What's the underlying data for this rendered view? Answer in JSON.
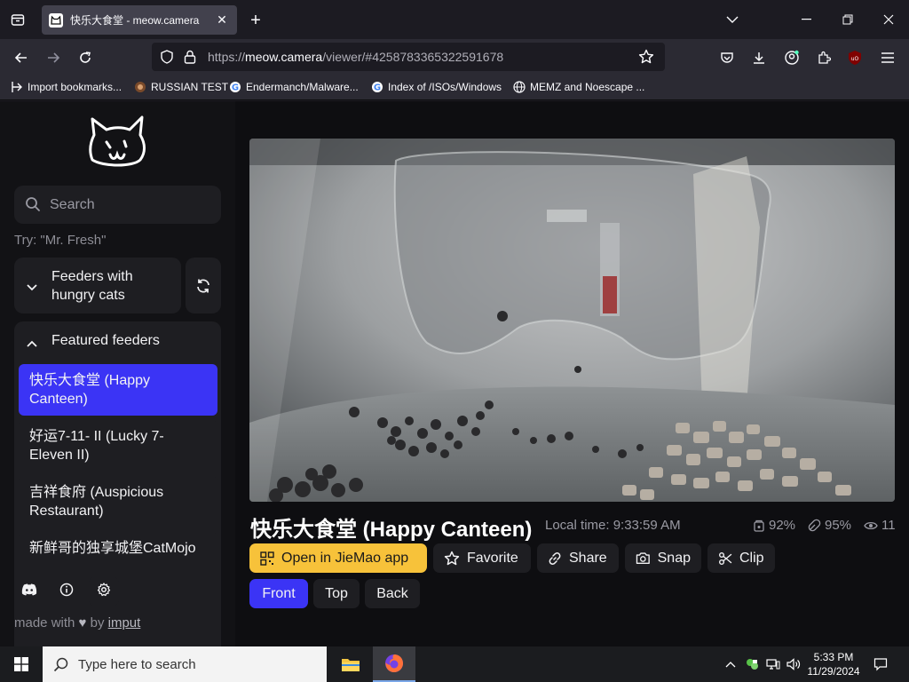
{
  "browser": {
    "tab_title": "快乐大食堂 - meow.camera",
    "url_prefix": "https://",
    "url_host": "meow.camera",
    "url_path": "/viewer/#4258783365322591678",
    "bookmarks": [
      {
        "label": "Import bookmarks...",
        "icon": "import-icon"
      },
      {
        "label": "RUSSIAN TEST",
        "icon": "site-favicon"
      },
      {
        "label": "Endermanch/Malware...",
        "icon": "google-icon"
      },
      {
        "label": "Index of /ISOs/Windows",
        "icon": "google-icon"
      },
      {
        "label": "MEMZ and Noescape ...",
        "icon": "globe-icon"
      }
    ]
  },
  "sidebar": {
    "search_placeholder": "Search",
    "try_hint": "Try: \"Mr. Fresh\"",
    "hungry_label_1": "Feeders with",
    "hungry_label_2": "hungry cats",
    "featured_label": "Featured feeders",
    "feeders": [
      {
        "line1": "快乐大食堂 (Happy",
        "line2": "Canteen)",
        "active": true
      },
      {
        "line1": "好运7-11- II  (Lucky 7-",
        "line2": "Eleven II)",
        "active": false
      },
      {
        "line1": "吉祥食府 (Auspicious",
        "line2": "Restaurant)",
        "active": false
      },
      {
        "line1": "新鲜哥的独享城堡CatMojo",
        "line2": "",
        "active": false
      }
    ],
    "made_with_prefix": "made with",
    "made_with_by": "by",
    "made_with_author": "imput"
  },
  "viewer": {
    "title": "快乐大食堂 (Happy Canteen)",
    "local_time": "Local time: 9:33:59 AM",
    "food_level": "92%",
    "health": "95%",
    "viewers": "11",
    "actions": {
      "open_app": "Open in JieMao app",
      "favorite": "Favorite",
      "share": "Share",
      "snap": "Snap",
      "clip": "Clip"
    },
    "views": [
      "Front",
      "Top",
      "Back"
    ],
    "active_view": "Front"
  },
  "taskbar": {
    "search_placeholder": "Type here to search",
    "time": "5:33 PM",
    "date": "11/29/2024"
  },
  "colors": {
    "accent_blue": "#3b34f5",
    "accent_yellow": "#f7c23a",
    "sidebar_bg": "#121215",
    "card_bg": "#1e1e22"
  }
}
